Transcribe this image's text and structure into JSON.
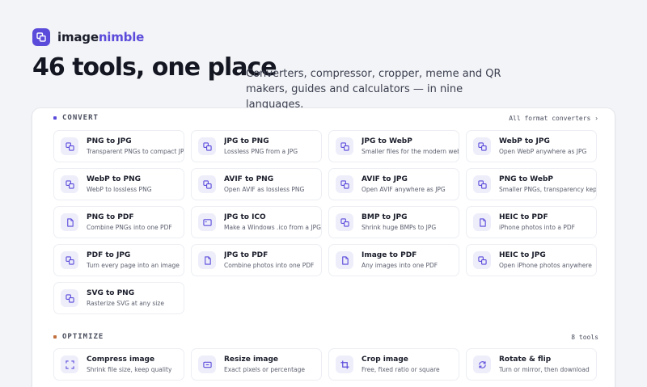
{
  "brand": {
    "name_part1": "image",
    "name_part2": "nimble",
    "logo_icon": "overlapping-squares-icon",
    "accent": "#5b4bdb"
  },
  "hero": {
    "title": "46 tools, one place",
    "subtitle": "Converters, compressor, cropper, meme and QR makers, guides and calculators — in nine languages."
  },
  "sections": {
    "convert": {
      "label": "CONVERT",
      "dot_color": "#5b4bdb",
      "meta": "All format converters ›",
      "tools": [
        {
          "title": "PNG to JPG",
          "desc": "Transparent PNGs to compact JPGs",
          "icon": "convert-icon"
        },
        {
          "title": "JPG to PNG",
          "desc": "Lossless PNG from a JPG",
          "icon": "convert-icon"
        },
        {
          "title": "JPG to WebP",
          "desc": "Smaller files for the modern web",
          "icon": "convert-icon"
        },
        {
          "title": "WebP to JPG",
          "desc": "Open WebP anywhere as JPG",
          "icon": "convert-icon"
        },
        {
          "title": "WebP to PNG",
          "desc": "WebP to lossless PNG",
          "icon": "convert-icon"
        },
        {
          "title": "AVIF to PNG",
          "desc": "Open AVIF as lossless PNG",
          "icon": "convert-icon"
        },
        {
          "title": "AVIF to JPG",
          "desc": "Open AVIF anywhere as JPG",
          "icon": "convert-icon"
        },
        {
          "title": "PNG to WebP",
          "desc": "Smaller PNGs, transparency kept",
          "icon": "convert-icon"
        },
        {
          "title": "PNG to PDF",
          "desc": "Combine PNGs into one PDF",
          "icon": "document-icon"
        },
        {
          "title": "JPG to ICO",
          "desc": "Make a Windows .ico from a JPG",
          "icon": "window-icon"
        },
        {
          "title": "BMP to JPG",
          "desc": "Shrink huge BMPs to JPG",
          "icon": "convert-icon"
        },
        {
          "title": "HEIC to PDF",
          "desc": "iPhone photos into a PDF",
          "icon": "document-icon"
        },
        {
          "title": "PDF to JPG",
          "desc": "Turn every page into an image",
          "icon": "convert-icon"
        },
        {
          "title": "JPG to PDF",
          "desc": "Combine photos into one PDF",
          "icon": "document-icon"
        },
        {
          "title": "Image to PDF",
          "desc": "Any images into one PDF",
          "icon": "document-icon"
        },
        {
          "title": "HEIC to JPG",
          "desc": "Open iPhone photos anywhere",
          "icon": "convert-icon"
        },
        {
          "title": "SVG to PNG",
          "desc": "Rasterize SVG at any size",
          "icon": "convert-icon"
        }
      ]
    },
    "optimize": {
      "label": "OPTIMIZE",
      "dot_color": "#c2703d",
      "meta": "8 tools",
      "tools": [
        {
          "title": "Compress image",
          "desc": "Shrink file size, keep quality",
          "icon": "compress-icon"
        },
        {
          "title": "Resize image",
          "desc": "Exact pixels or percentage",
          "icon": "resize-icon"
        },
        {
          "title": "Crop image",
          "desc": "Free, fixed ratio or square",
          "icon": "crop-icon"
        },
        {
          "title": "Rotate & flip",
          "desc": "Turn or mirror, then download",
          "icon": "rotate-icon"
        }
      ]
    }
  }
}
